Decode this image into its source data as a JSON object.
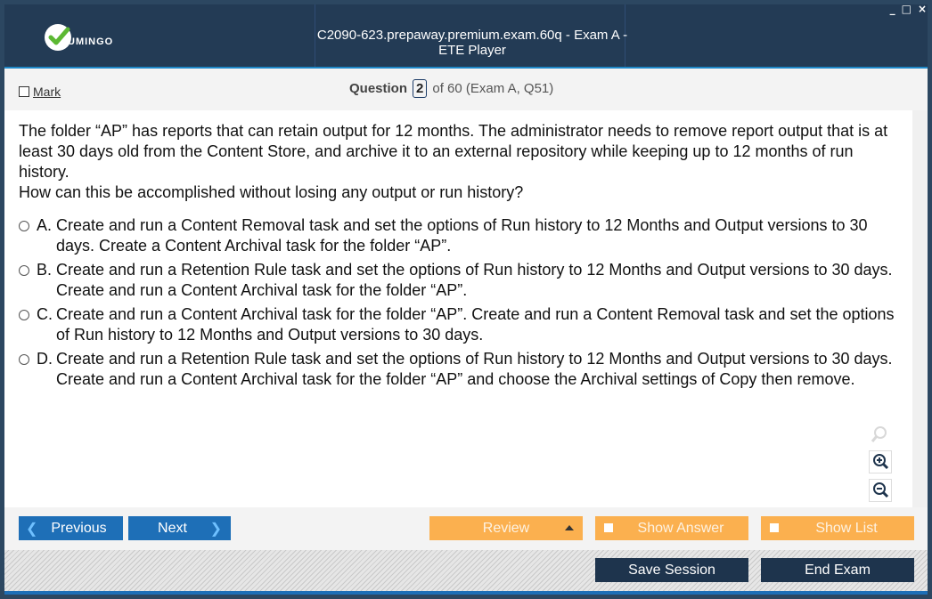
{
  "window": {
    "title": "C2090-623.prepaway.premium.exam.60q - Exam A - ETE Player",
    "controls": [
      "_",
      "□",
      "×"
    ]
  },
  "logo": {
    "text": "UMINGO",
    "icon": "check-icon"
  },
  "question_bar": {
    "mark_label": "Mark",
    "question_label": "Question",
    "current": "2",
    "of_text": "of 60 (Exam A, Q51)"
  },
  "question": {
    "paragraph1": "The folder “AP” has reports that can retain output for 12 months. The administrator needs to remove report output that is at least 30 days old from the Content Store, and archive it to an external repository while keeping up to 12 months of run history.",
    "paragraph2": "How can this be accomplished without losing any output or run history?"
  },
  "answers": [
    {
      "letter": "A.",
      "text": "Create and run a Content Removal task and set the options of Run history to 12 Months and Output versions to 30 days. Create a Content Archival task for the folder “AP”."
    },
    {
      "letter": "B.",
      "text": "Create and run a Retention Rule task and set the options of Run history to 12 Months and Output versions to 30 days. Create and run a Content Archival task for the folder “AP”."
    },
    {
      "letter": "C.",
      "text": "Create and run a Content Archival task for the folder “AP”. Create and run a Content Removal task and set the options of Run history to 12 Months and Output versions to 30 days."
    },
    {
      "letter": "D.",
      "text": "Create and run a Retention Rule task and set the options of Run history to 12 Months and Output versions to 30 days. Create and run a Content Archival task for the folder “AP” and choose the Archival settings of Copy then remove."
    }
  ],
  "zoom": [
    "search-icon",
    "zoom-in-icon",
    "zoom-out-icon"
  ],
  "nav": {
    "previous": "Previous",
    "next": "Next",
    "review": "Review",
    "show_answer": "Show Answer",
    "show_list": "Show List",
    "save_session": "Save Session",
    "end_exam": "End Exam"
  },
  "colors": {
    "accent_blue": "#1e6fb7",
    "orange": "#fbb04f",
    "dark": "#1e344d",
    "titlebar": "#233b55"
  }
}
